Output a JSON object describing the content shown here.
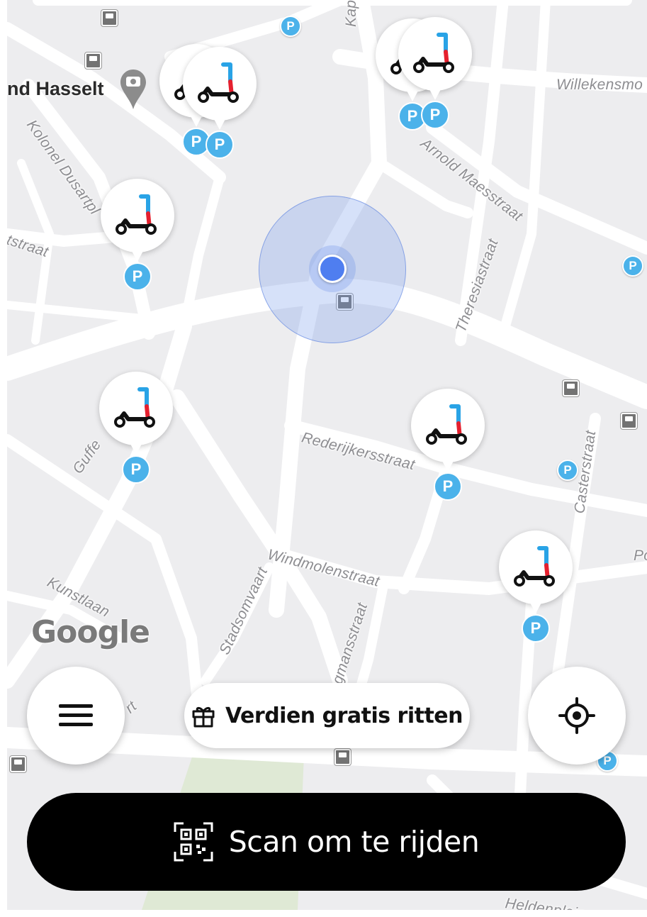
{
  "map": {
    "place_label": "nd Hasselt",
    "street_labels": {
      "kaperm": "Kaperm",
      "willekensmo": "Willekensmo",
      "kolonel": "Kolonel Dusartpl",
      "arnold": "Arnold Maesstraat",
      "tstraat": "tstraat",
      "theresia": "Theresiastraat",
      "rederijkers": "Rederijkersstraat",
      "casterstraat": "Casterstraat",
      "guffe": "Guffe",
      "windmolen": "Windmolenstraat",
      "kunstlaan": "Kunstlaan",
      "stadsomvaart": "Stadsomvaart",
      "gmansstraat": "gmansstraat",
      "heldenplein": "Heldenplein",
      "po": "Po",
      "rt": "rt"
    },
    "parking_glyph": "P",
    "scooter_count": 8,
    "google_logo": "Google"
  },
  "controls": {
    "menu_icon": "hamburger-menu-icon",
    "referral_label": "Verdien gratis ritten",
    "referral_icon": "gift-icon",
    "locate_icon": "crosshair-icon",
    "scan_label": "Scan om te rijden",
    "scan_icon": "qr-code-icon"
  },
  "colors": {
    "scan_button": "#000000",
    "parking": "#4bb2ea",
    "user_location": "#4f7ef0",
    "scooter_stem_blue": "#29a3e6",
    "scooter_stem_red": "#e5202e"
  }
}
